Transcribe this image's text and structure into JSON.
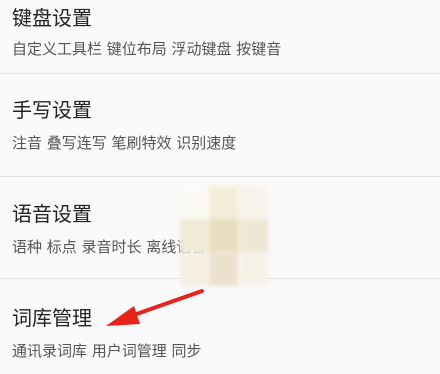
{
  "settings": {
    "items": [
      {
        "title": "键盘设置",
        "desc": "自定义工具栏 键位布局 浮动键盘 按键音"
      },
      {
        "title": "手写设置",
        "desc": "注音 叠写连写 笔刷特效 识别速度"
      },
      {
        "title": "语音设置",
        "desc": "语种 标点 录音时长 离线语音"
      },
      {
        "title": "词库管理",
        "desc": "通讯录词库 用户词管理 同步"
      }
    ]
  },
  "annotation": {
    "arrow_color": "#e8231c"
  },
  "colors": {
    "background": "#fafafa",
    "divider": "#e2e2e2",
    "title": "#222222",
    "description": "#555555"
  }
}
